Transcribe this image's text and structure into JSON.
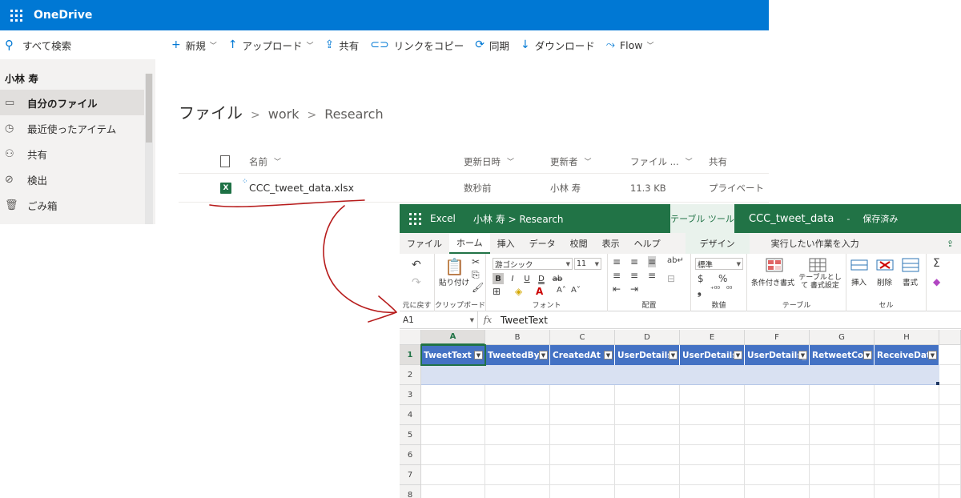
{
  "onedrive": {
    "brand": "OneDrive",
    "search_label": "すべて検索",
    "commands": [
      {
        "icon": "+",
        "label": "新規",
        "chevron": true
      },
      {
        "icon": "↑",
        "label": "アップロード",
        "chevron": true
      },
      {
        "icon": "⇪",
        "label": "共有",
        "chevron": false
      },
      {
        "icon": "⊂⊃",
        "label": "リンクをコピー",
        "chevron": false
      },
      {
        "icon": "⟳",
        "label": "同期",
        "chevron": false
      },
      {
        "icon": "↓",
        "label": "ダウンロード",
        "chevron": false
      },
      {
        "icon": "⤳",
        "label": "Flow",
        "chevron": true
      }
    ],
    "user_name": "小林 寿",
    "nav": [
      {
        "icon": "▭",
        "label": "自分のファイル",
        "selected": true
      },
      {
        "icon": "◷",
        "label": "最近使ったアイテム",
        "selected": false
      },
      {
        "icon": "⚇",
        "label": "共有",
        "selected": false
      },
      {
        "icon": "⊘",
        "label": "検出",
        "selected": false
      },
      {
        "icon": "🗑",
        "label": "ごみ箱",
        "selected": false
      }
    ],
    "breadcrumb": {
      "root": "ファイル",
      "items": [
        "work",
        "Research"
      ],
      "separator": ">"
    },
    "columns": {
      "name": "名前",
      "modified": "更新日時",
      "modified_by": "更新者",
      "size": "ファイル ...",
      "sharing": "共有"
    },
    "files": [
      {
        "name": "CCC_tweet_data.xlsx",
        "modified": "数秒前",
        "modified_by": "小林 寿",
        "size": "11.3 KB",
        "sharing": "プライベート"
      }
    ]
  },
  "excel": {
    "app": "Excel",
    "path": "小林 寿 > Research",
    "tool_tab": "テーブル ツール",
    "doc_name": "CCC_tweet_data",
    "doc_sep": "-",
    "status": "保存済み",
    "menu": [
      "ファイル",
      "ホーム",
      "挿入",
      "データ",
      "校閲",
      "表示",
      "ヘルプ"
    ],
    "active_menu": "ホーム",
    "design_tab": "デザイン",
    "tell_me": "実行したい作業を入力",
    "ribbon": {
      "undo_label": "元に戻す",
      "paste_label": "貼り付け",
      "clipboard_label": "クリップボード",
      "font_name": "游ゴシック",
      "font_size": "11",
      "font_label": "フォント",
      "align_label": "配置",
      "number_format": "標準",
      "number_label": "数値",
      "cond_format": "条件付き書式",
      "format_table": "テーブルとして 書式設定",
      "styles_label": "テーブル",
      "insert": "挿入",
      "delete": "削除",
      "format": "書式",
      "cells_label": "セル",
      "currency": "$",
      "percent": "%",
      "bold": "B",
      "italic": "I",
      "underline": "U",
      "double_underline": "D",
      "strike": "ab"
    },
    "name_box": "A1",
    "fx": "fx",
    "formula": "TweetText",
    "col_letters": [
      "A",
      "B",
      "C",
      "D",
      "E",
      "F",
      "G",
      "H"
    ],
    "row_numbers": [
      "1",
      "2",
      "3",
      "4",
      "5",
      "6",
      "7",
      "8"
    ],
    "headers": [
      "TweetText",
      "TweetedBy",
      "CreatedAt",
      "UserDetails",
      "UserDetails",
      "UserDetails_",
      "RetweetCou",
      "ReceiveDate"
    ],
    "header_color": "#4472c4",
    "accent": "#217346"
  }
}
